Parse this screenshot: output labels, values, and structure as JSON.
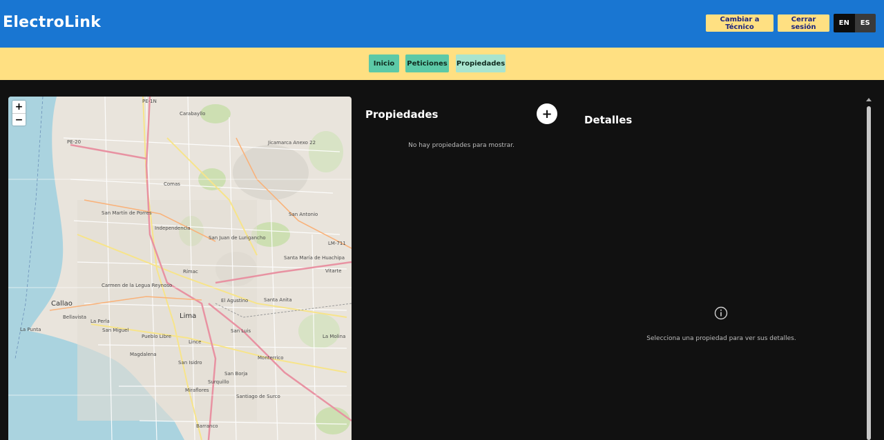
{
  "header": {
    "brand": "ElectroLink",
    "switch_role_label": "Cambiar a Técnico",
    "logout_label": "Cerrar sesión",
    "lang_en": "EN",
    "lang_es": "ES"
  },
  "nav": {
    "inicio": "Inicio",
    "peticiones": "Peticiones",
    "propiedades": "Propiedades"
  },
  "map": {
    "zoom_in": "+",
    "zoom_out": "−",
    "labels": {
      "carabayllo": "Carabayllo",
      "jicamarca": "Jicamarca Anexo 22",
      "comas": "Comas",
      "san_martin": "San Martín de Porres",
      "independencia": "Independencia",
      "san_juan": "San Juan de Lurigancho",
      "san_antonio": "San Antonio",
      "santa_maria": "Santa María de Huachipa",
      "rimac": "Rímac",
      "carmen": "Carmen de la Legua Reynoso",
      "callao": "Callao",
      "el_agustino": "El Agustino",
      "santa_anita": "Santa Anita",
      "vitarte": "Vitarte",
      "lima": "Lima",
      "bellavista": "Bellavista",
      "la_perla": "La Perla",
      "la_punta": "La Punta",
      "san_miguel": "San Miguel",
      "pueblo_libre": "Pueblo Libre",
      "lince": "Lince",
      "san_luis": "San Luis",
      "la_molina": "La Molina",
      "magdalena": "Magdalena",
      "san_isidro": "San Isidro",
      "monterrico": "Monterrico",
      "san_borja": "San Borja",
      "surquillo": "Surquillo",
      "miraflores": "Miraflores",
      "surco": "Santiago de Surco",
      "barranco": "Barranco",
      "pe1n": "PE-1N",
      "pe20": "PE-20",
      "lm711": "LM-711"
    }
  },
  "properties": {
    "title": "Propiedades",
    "add_label": "+",
    "empty": "No hay propiedades para mostrar."
  },
  "details": {
    "title": "Detalles",
    "empty": "Selecciona una propiedad para ver sus detalles."
  }
}
